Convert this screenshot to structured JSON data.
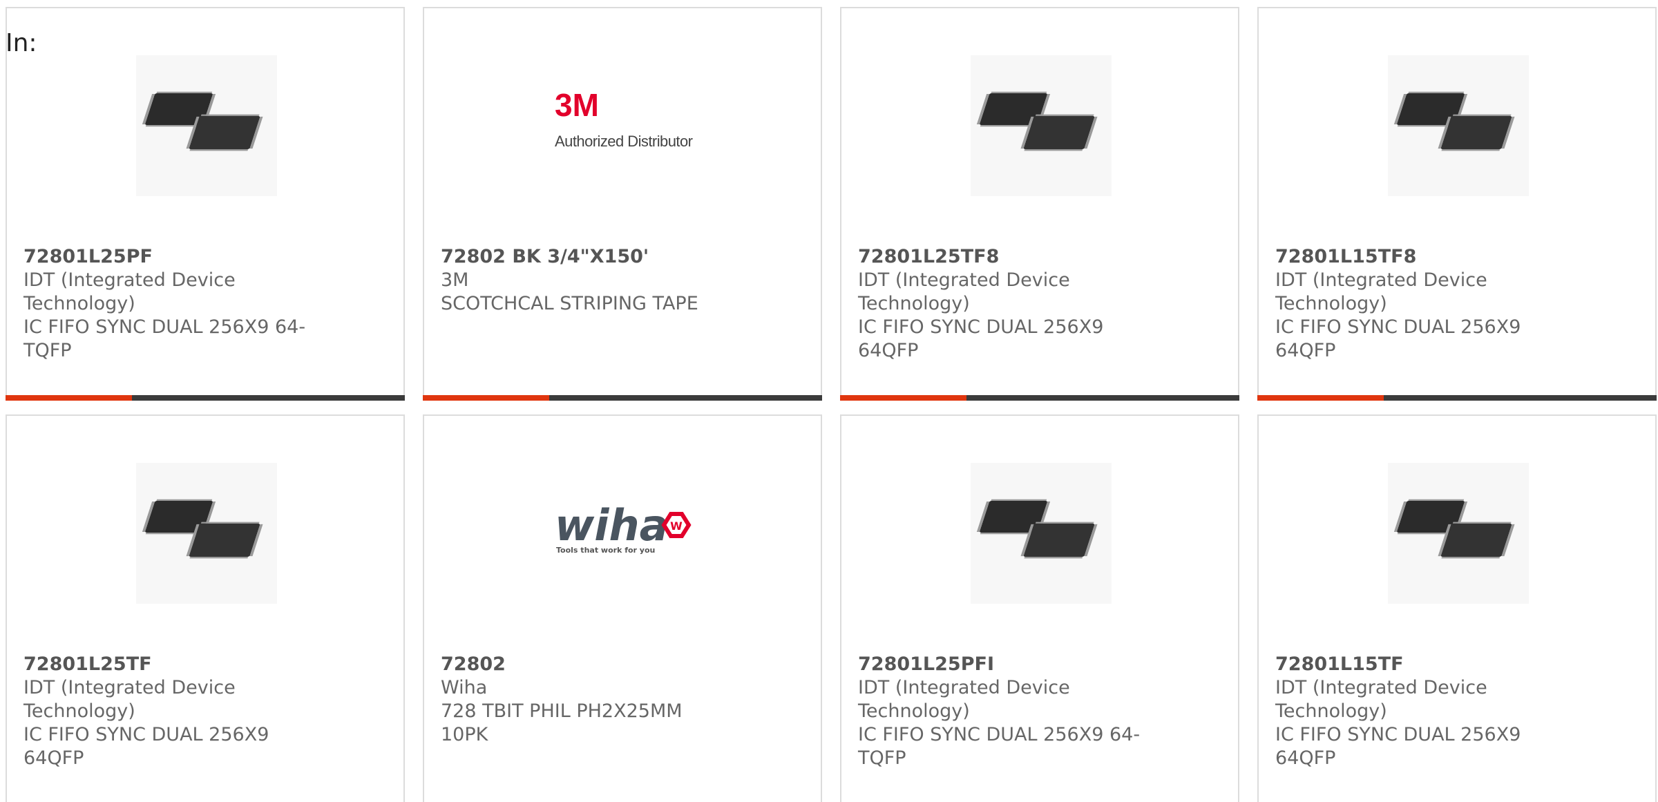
{
  "header": {
    "in_label": "In:"
  },
  "products": [
    {
      "part_number": "72801L25PF",
      "manufacturer": "IDT (Integrated Device Technology)",
      "description": "IC FIFO SYNC DUAL 256X9 64-TQFP",
      "image_icon": "qfp-chip-icon"
    },
    {
      "part_number": "72802 BK 3/4\"X150'",
      "manufacturer": "3M",
      "description": "SCOTCHCAL STRIPING TAPE",
      "image_icon": "3m-logo",
      "logo_text": "3M",
      "logo_subtext": "Authorized Distributor"
    },
    {
      "part_number": "72801L25TF8",
      "manufacturer": "IDT (Integrated Device Technology)",
      "description": "IC FIFO SYNC DUAL 256X9 64QFP",
      "image_icon": "qfp-chip-icon"
    },
    {
      "part_number": "72801L15TF8",
      "manufacturer": "IDT (Integrated Device Technology)",
      "description": "IC FIFO SYNC DUAL 256X9 64QFP",
      "image_icon": "qfp-chip-icon"
    },
    {
      "part_number": "72801L25TF",
      "manufacturer": "IDT (Integrated Device Technology)",
      "description": "IC FIFO SYNC DUAL 256X9 64QFP",
      "image_icon": "qfp-chip-icon"
    },
    {
      "part_number": "72802",
      "manufacturer": "Wiha",
      "description": "728 TBIT PHIL PH2X25MM 10PK",
      "image_icon": "wiha-logo",
      "logo_text": "wiha",
      "logo_subtext": "Tools that work for you"
    },
    {
      "part_number": "72801L25PFI",
      "manufacturer": "IDT (Integrated Device Technology)",
      "description": "IC FIFO SYNC DUAL 256X9 64-TQFP",
      "image_icon": "qfp-chip-icon"
    },
    {
      "part_number": "72801L15TF",
      "manufacturer": "IDT (Integrated Device Technology)",
      "description": "IC FIFO SYNC DUAL 256X9 64QFP",
      "image_icon": "qfp-chip-icon"
    }
  ],
  "colors": {
    "accent": "#e0360f",
    "bar_dark": "#3b3b3b",
    "logo_3m": "#e2002b",
    "logo_wiha": "#4a5560"
  }
}
